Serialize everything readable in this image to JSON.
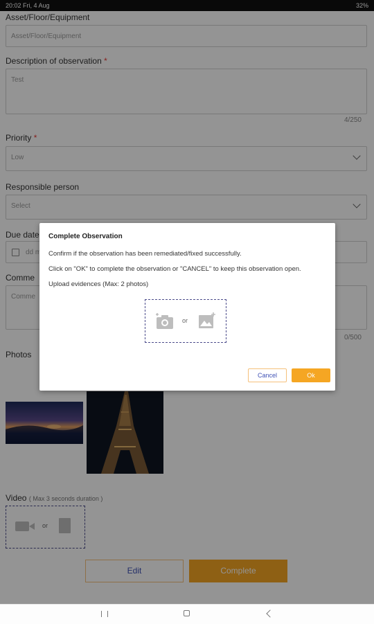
{
  "status_bar": {
    "time_date": "20:02  Fri, 4 Aug",
    "battery": "32%"
  },
  "form": {
    "asset": {
      "label": "Asset/Floor/Equipment",
      "placeholder": "Asset/Floor/Equipment"
    },
    "description": {
      "label": "Description of observation",
      "required_mark": "*",
      "value": "Test",
      "counter": "4/250"
    },
    "priority": {
      "label": "Priority",
      "required_mark": "*",
      "value": "Low"
    },
    "responsible": {
      "label": "Responsible person",
      "placeholder": "Select"
    },
    "due_date": {
      "label": "Due date",
      "value": "dd m"
    },
    "comments": {
      "label": "Comme",
      "placeholder": "Comme",
      "counter": "0/500"
    },
    "photos": {
      "label": "Photos"
    },
    "video": {
      "label": "Video",
      "hint": "( Max 3 seconds duration )",
      "or_text": "or"
    },
    "edit_button": "Edit",
    "complete_button": "Complete"
  },
  "dialog": {
    "title": "Complete Observation",
    "line1": "Confirm if the observation has been remediated/fixed successfully.",
    "line2": "Click on \"OK\" to complete the observation or \"CANCEL\" to keep this observation open.",
    "line3": "Upload evidences (Max: 2 photos)",
    "or_text": "or",
    "cancel_button": "Cancel",
    "ok_button": "Ok"
  },
  "colors": {
    "accent": "#f5a623",
    "dashed_border": "#4a4a8a",
    "edit_text": "#3f51b5"
  }
}
